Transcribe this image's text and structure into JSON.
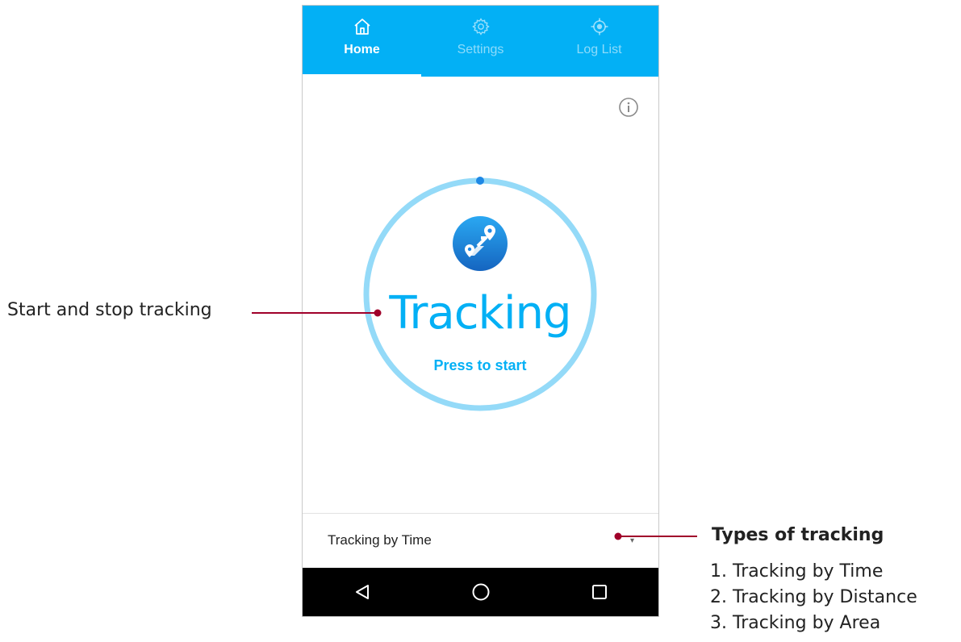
{
  "tabs": [
    {
      "label": "Home",
      "icon": "home-icon",
      "active": true
    },
    {
      "label": "Settings",
      "icon": "gear-icon",
      "active": false
    },
    {
      "label": "Log List",
      "icon": "crosshair-icon",
      "active": false
    }
  ],
  "info_icon": "info-icon",
  "tracking": {
    "title": "Tracking",
    "subtitle": "Press to start",
    "logo_icon": "route-pin-icon"
  },
  "mode_selector": {
    "value": "Tracking by Time"
  },
  "nav": {
    "back_icon": "back-triangle-icon",
    "home_icon": "home-circle-icon",
    "recents_icon": "recents-square-icon"
  },
  "annotations": {
    "left_label": "Start and stop tracking",
    "right_title": "Types of tracking",
    "right_items": [
      "1. Tracking by Time",
      "2. Tracking by Distance",
      "3. Tracking by Area"
    ]
  },
  "colors": {
    "accent": "#03b0f5",
    "ring": "#94daf8",
    "callout": "#a0002a",
    "navbar": "#000000"
  }
}
